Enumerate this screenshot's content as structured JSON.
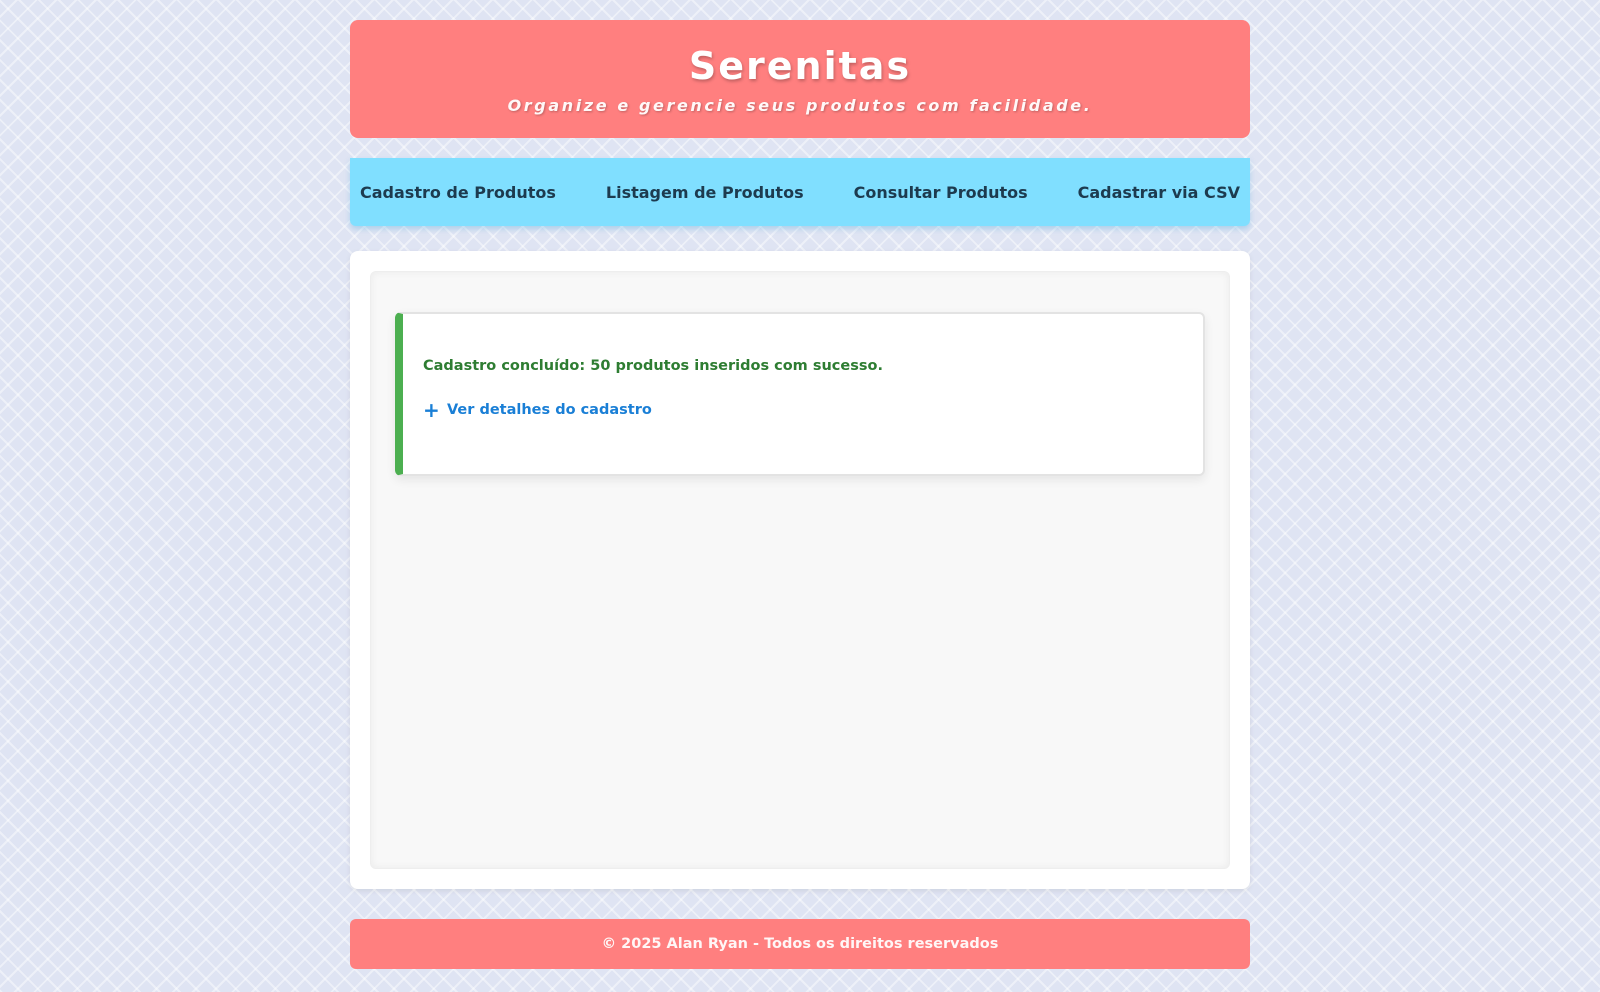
{
  "header": {
    "title": "Serenitas",
    "subtitle": "Organize e gerencie seus produtos com facilidade."
  },
  "nav": {
    "items": [
      {
        "label": "Cadastro de Produtos"
      },
      {
        "label": "Listagem de Produtos"
      },
      {
        "label": "Consultar Produtos"
      },
      {
        "label": "Cadastrar via CSV"
      }
    ]
  },
  "alert": {
    "message": "Cadastro concluído: 50 produtos inseridos com sucesso.",
    "details_icon": "+",
    "details_label": "Ver detalhes do cadastro"
  },
  "footer": {
    "text": "© 2025 Alan Ryan - Todos os direitos reservados"
  },
  "colors": {
    "header_bg": "#ff7f7f",
    "nav_bg": "#80dfff",
    "success_accent": "#4caf50",
    "success_text": "#2e7d32",
    "link_blue": "#1a7fd6"
  }
}
